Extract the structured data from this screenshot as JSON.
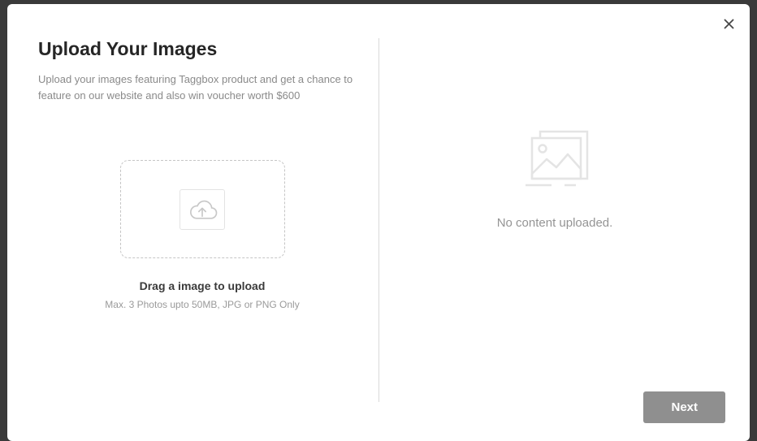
{
  "modal": {
    "title": "Upload Your Images",
    "subtitle": "Upload your images featuring Taggbox product and get a chance to feature on our website and also win voucher worth $600"
  },
  "dropzone": {
    "drag_label": "Drag a image to upload",
    "hint": "Max. 3 Photos upto 50MB, JPG or PNG Only"
  },
  "preview": {
    "empty_label": "No content uploaded."
  },
  "actions": {
    "next_label": "Next"
  }
}
